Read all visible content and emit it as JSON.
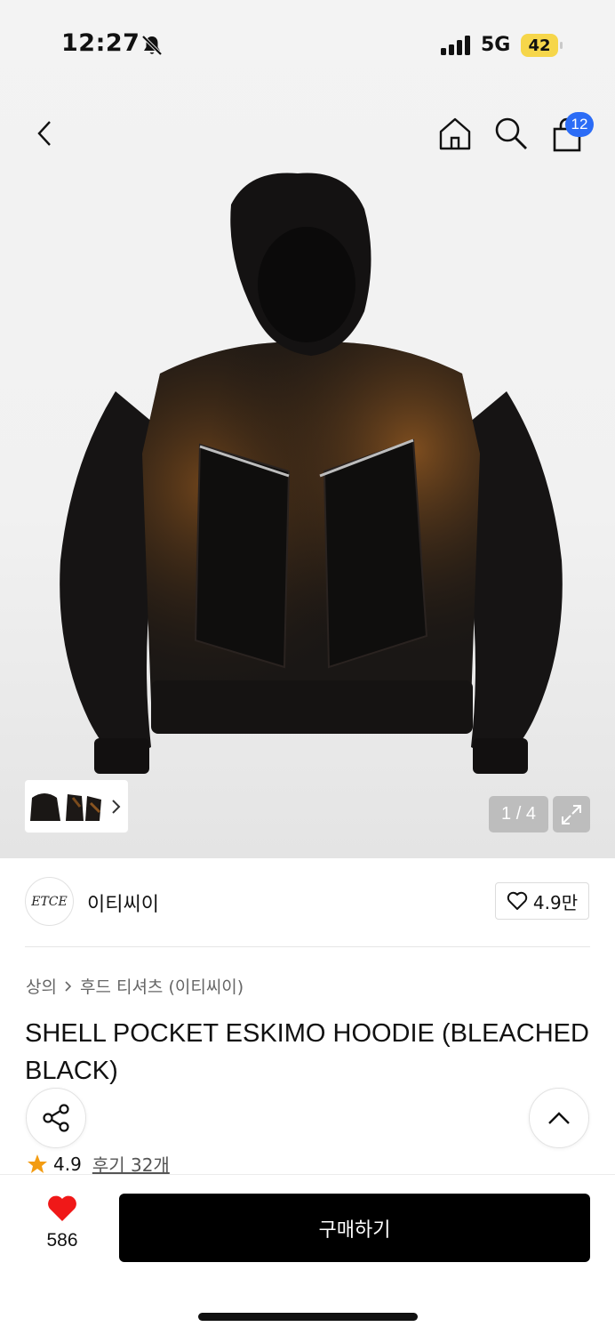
{
  "status_bar": {
    "time": "12:27",
    "network": "5G",
    "battery": "42"
  },
  "header": {
    "cart_count": "12"
  },
  "gallery": {
    "counter": "1 / 4"
  },
  "brand": {
    "logo_text": "ETCE",
    "name": "이티씨이",
    "likes": "4.9만"
  },
  "breadcrumb": {
    "category": "상의",
    "subcategory": "후드 티셔츠 (이티씨이)"
  },
  "product": {
    "title": "SHELL POCKET ESKIMO HOODIE (BLEACHED BLACK)",
    "rating": "4.9",
    "reviews": "후기 32개"
  },
  "bottom": {
    "wish_count": "586",
    "buy_label": "구매하기"
  },
  "colors": {
    "accent": "#2b6cf6",
    "heart": "#f01818",
    "star": "#f39c12",
    "battery": "#f6d64a"
  }
}
